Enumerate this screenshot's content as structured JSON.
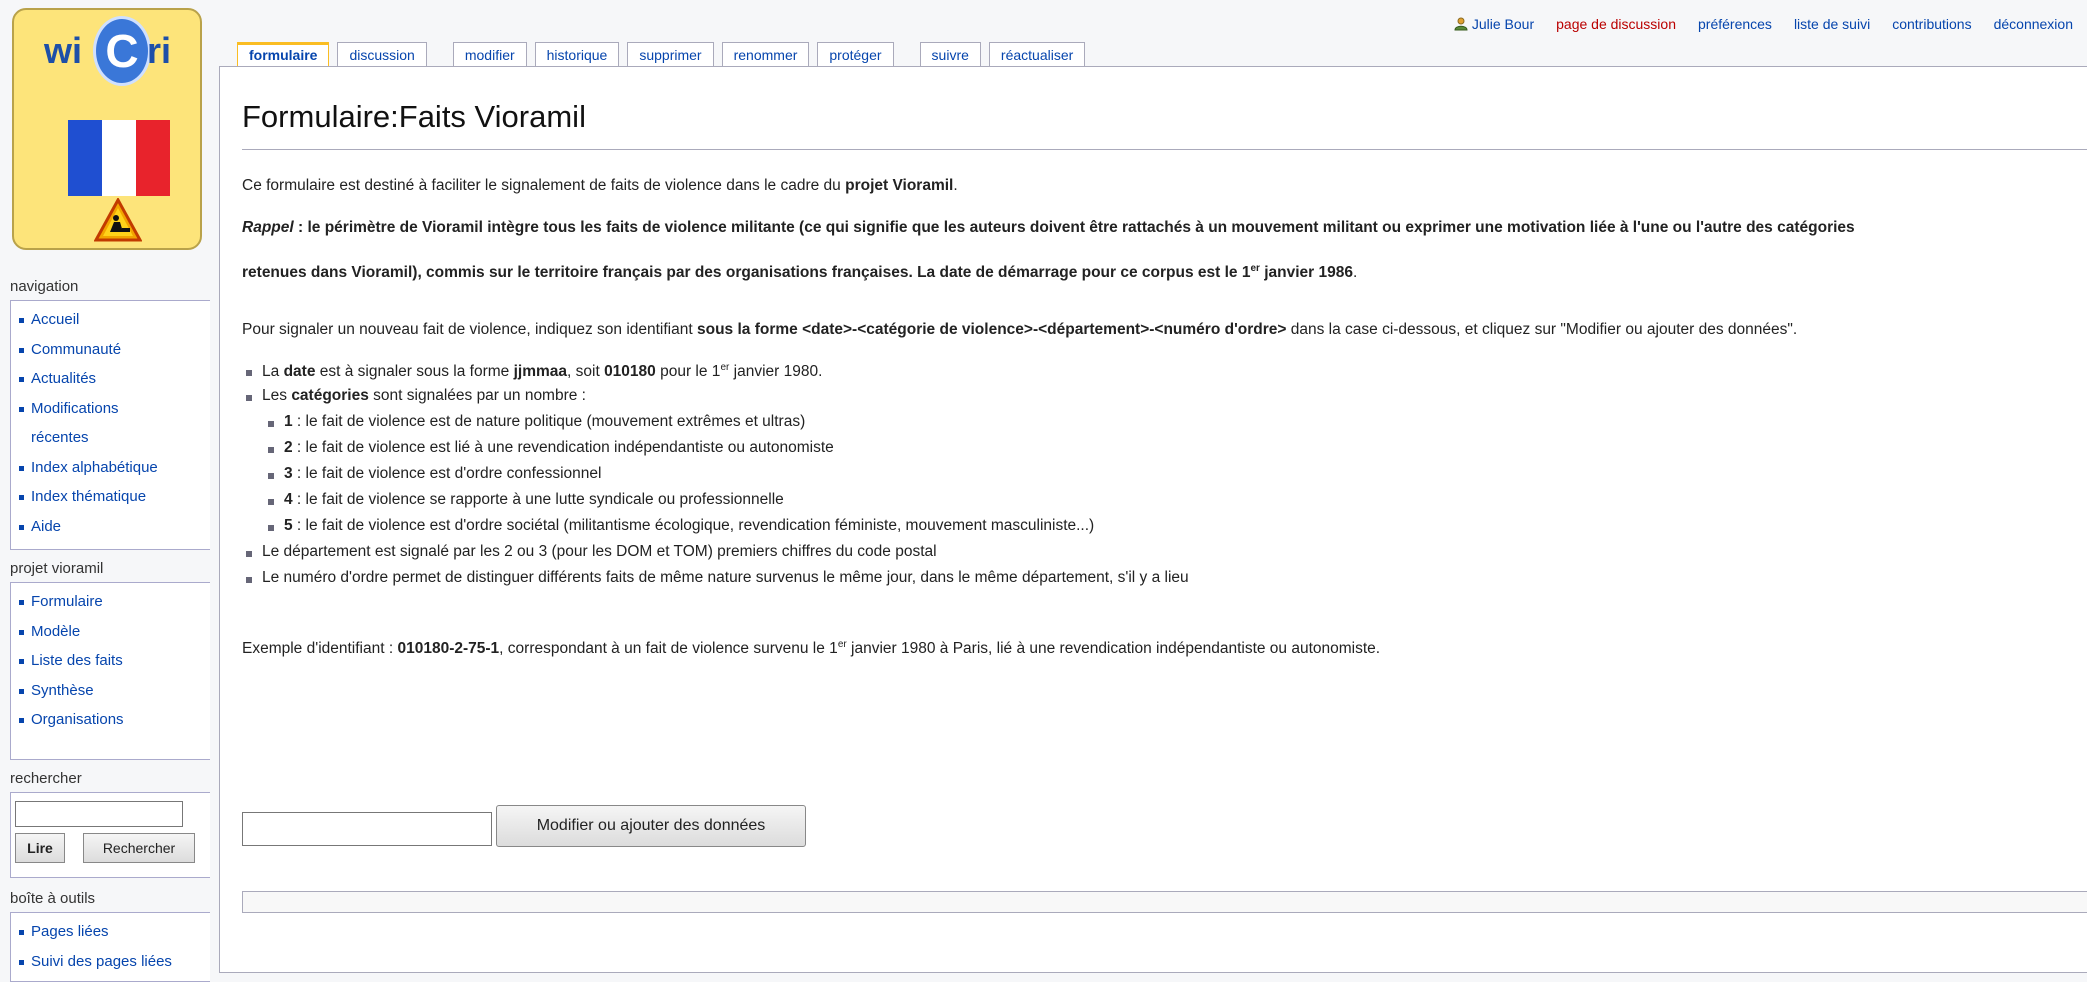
{
  "logo": {
    "left_text": "wi",
    "center_text": "C",
    "right_text": "ri",
    "flag_colors": [
      "#1f4fd1",
      "#ffffff",
      "#e8232c"
    ]
  },
  "personal": {
    "user": "Julie Bour",
    "links": [
      "page de discussion",
      "préférences",
      "liste de suivi",
      "contributions",
      "déconnexion"
    ],
    "discussion_color": "#ba0000"
  },
  "tabs": [
    "formulaire",
    "discussion",
    "modifier",
    "historique",
    "supprimer",
    "renommer",
    "protéger",
    "suivre",
    "réactualiser"
  ],
  "page": {
    "title": "Formulaire:Faits Vioramil",
    "intro_prefix": "Ce formulaire est destiné à faciliter le signalement de faits de violence dans le cadre du ",
    "intro_bold": "projet Vioramil",
    "intro_suffix": ".",
    "rappel_label": "Rappel",
    "rappel_line1": " : le périmètre de Vioramil intègre tous les faits de violence militante (ce qui signifie que les auteurs doivent être rattachés à un mouvement militant ou exprimer une motivation liée à l'une ou l'autre des catégories",
    "rappel_line2_a": "retenues dans Vioramil), commis sur le territoire français par des organisations françaises. La date de démarrage pour ce corpus est le 1",
    "rappel_line2_sup": "er",
    "rappel_line2_b": " janvier 1986",
    "rappel_line2_end": ".",
    "instr_prefix": "Pour signaler un nouveau fait de violence, indiquez son identifiant ",
    "instr_bold": "sous la forme <date>-<catégorie de violence>-<département>-<numéro d'ordre>",
    "instr_suffix": " dans la case ci-dessous, et cliquez sur \"Modifier ou ajouter des données\".",
    "b_date_a": "La ",
    "b_date_bold": "date",
    "b_date_b": " est à signaler sous la forme ",
    "b_date_bold2": "jjmmaa",
    "b_date_c": ", soit ",
    "b_date_bold3": "010180",
    "b_date_d": " pour le 1",
    "b_date_sup": "er",
    "b_date_e": " janvier 1980.",
    "b_cat_a": "Les ",
    "b_cat_bold": "catégories",
    "b_cat_b": " sont signalées par un nombre :",
    "categories": [
      {
        "num": "1",
        "text": " : le fait de violence est de nature politique (mouvement extrêmes et ultras)"
      },
      {
        "num": "2",
        "text": " : le fait de violence est lié à une revendication indépendantiste ou autonomiste"
      },
      {
        "num": "3",
        "text": " : le fait de violence est d'ordre confessionnel"
      },
      {
        "num": "4",
        "text": " : le fait de violence se rapporte à une lutte syndicale ou professionnelle"
      },
      {
        "num": "5",
        "text": " : le fait de violence est d'ordre sociétal (militantisme écologique, revendication féministe, mouvement masculiniste...)"
      }
    ],
    "b_dept": "Le département est signalé par les 2 ou 3 (pour les DOM et TOM) premiers chiffres du code postal",
    "b_num": "Le numéro d'ordre permet de distinguer différents faits de même nature survenus le même jour, dans le même département, s'il y a lieu",
    "ex_a": "Exemple d'identifiant : ",
    "ex_bold": "010180-2-75-1",
    "ex_b": ", correspondant à un fait de violence survenu le 1",
    "ex_sup": "er",
    "ex_c": " janvier 1980 à Paris, lié à une revendication indépendantiste ou autonomiste.",
    "form_input_value": "",
    "form_button": "Modifier ou ajouter des données"
  },
  "sidebar": {
    "navigation_title": "navigation",
    "navigation": [
      "Accueil",
      "Communauté",
      "Actualités",
      "Modifications récentes",
      "Index alphabétique",
      "Index thématique",
      "Aide"
    ],
    "projet_title": "projet vioramil",
    "projet": [
      "Formulaire",
      "Modèle",
      "Liste des faits",
      "Synthèse",
      "Organisations"
    ],
    "search_title": "rechercher",
    "search_value": "",
    "search_go": "Lire",
    "search_button": "Rechercher",
    "tools_title": "boîte à outils",
    "tools": [
      "Pages liées",
      "Suivi des pages liées"
    ]
  }
}
